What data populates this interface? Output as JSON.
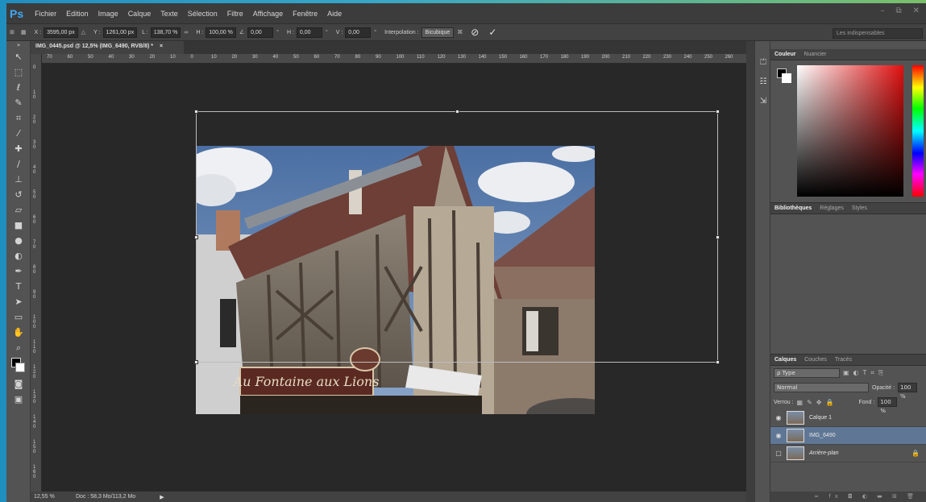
{
  "app": {
    "logo": "Ps"
  },
  "menu": [
    "Fichier",
    "Edition",
    "Image",
    "Calque",
    "Texte",
    "Sélection",
    "Filtre",
    "Affichage",
    "Fenêtre",
    "Aide"
  ],
  "window_controls": {
    "minimize": "–",
    "restore": "⧉",
    "close": "✕"
  },
  "options": {
    "x_label": "X :",
    "x_value": "3595,00 px",
    "y_label": "Y :",
    "y_value": "1261,00 px",
    "w_label": "L :",
    "w_value": "138,70 %",
    "h_label": "H :",
    "h_value": "100,00 %",
    "angle_value": "0,00",
    "deg": "°",
    "hskew_label": "H :",
    "hskew_value": "0,00",
    "vskew_label": "V :",
    "vskew_value": "0,00",
    "interp_label": "Interpolation :",
    "interp_value": "Bicubique",
    "workspace": "Les indispensables"
  },
  "document": {
    "tab_title": "IMG_0445.psd @ 12,5% (IMG_6490, RVB/8) *",
    "tab_close": "×",
    "ruler_h": [
      "70",
      "60",
      "50",
      "40",
      "30",
      "20",
      "10",
      "0",
      "10",
      "20",
      "30",
      "40",
      "50",
      "60",
      "70",
      "80",
      "90",
      "100",
      "110",
      "120",
      "130",
      "140",
      "150",
      "160",
      "170",
      "180",
      "190",
      "200",
      "210",
      "220",
      "230",
      "240",
      "250",
      "260"
    ],
    "ruler_v": [
      "0",
      "10",
      "20",
      "30",
      "40",
      "50",
      "60",
      "70",
      "80",
      "90",
      "100",
      "110",
      "120",
      "130",
      "140",
      "150",
      "160"
    ],
    "sign_text": "Au Fontaine aux Lions"
  },
  "status": {
    "zoom": "12,55 %",
    "doc": "Doc : 58,3 Mo/113,2 Mo",
    "arrow": "▶"
  },
  "panels": {
    "color_tabs": [
      "Couleur",
      "Nuancier"
    ],
    "library_tabs": [
      "Bibliothèques",
      "Réglages",
      "Styles"
    ],
    "layers_tabs": [
      "Calques",
      "Couches",
      "Tracés"
    ],
    "kind_filter": "ρ Type",
    "blend_mode": "Normal",
    "opacity_label": "Opacité :",
    "opacity_value": "100 %",
    "lock_label": "Verrou :",
    "fill_label": "Fond :",
    "fill_value": "100 %",
    "layers": [
      {
        "name": "Calque 1",
        "visible": true,
        "selected": false,
        "italic": false,
        "locked": false
      },
      {
        "name": "IMG_6490",
        "visible": true,
        "selected": true,
        "italic": false,
        "locked": false
      },
      {
        "name": "Arrière-plan",
        "visible": false,
        "selected": false,
        "italic": true,
        "locked": true
      }
    ]
  }
}
